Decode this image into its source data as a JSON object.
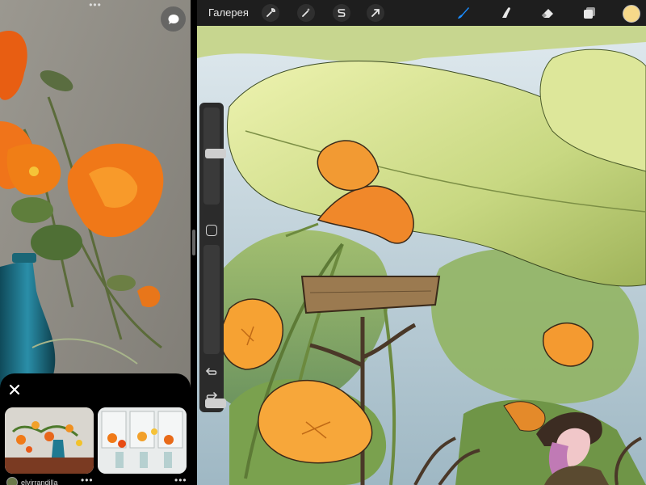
{
  "left_pane": {
    "related": {
      "items": [
        {
          "username": "elvirrandilla"
        },
        {
          "username": ""
        }
      ]
    }
  },
  "toolbar": {
    "gallery_label": "Галерея",
    "current_color": "#f7d98a",
    "active_tool_color": "#1a8cff"
  },
  "icons": {
    "actions": "wrench-icon",
    "adjustments": "magic-wand-icon",
    "selection": "selection-s-icon",
    "transform": "arrow-cursor-icon",
    "brush": "brush-icon",
    "smudge": "smudge-finger-icon",
    "eraser": "eraser-icon",
    "layers": "layers-icon"
  }
}
